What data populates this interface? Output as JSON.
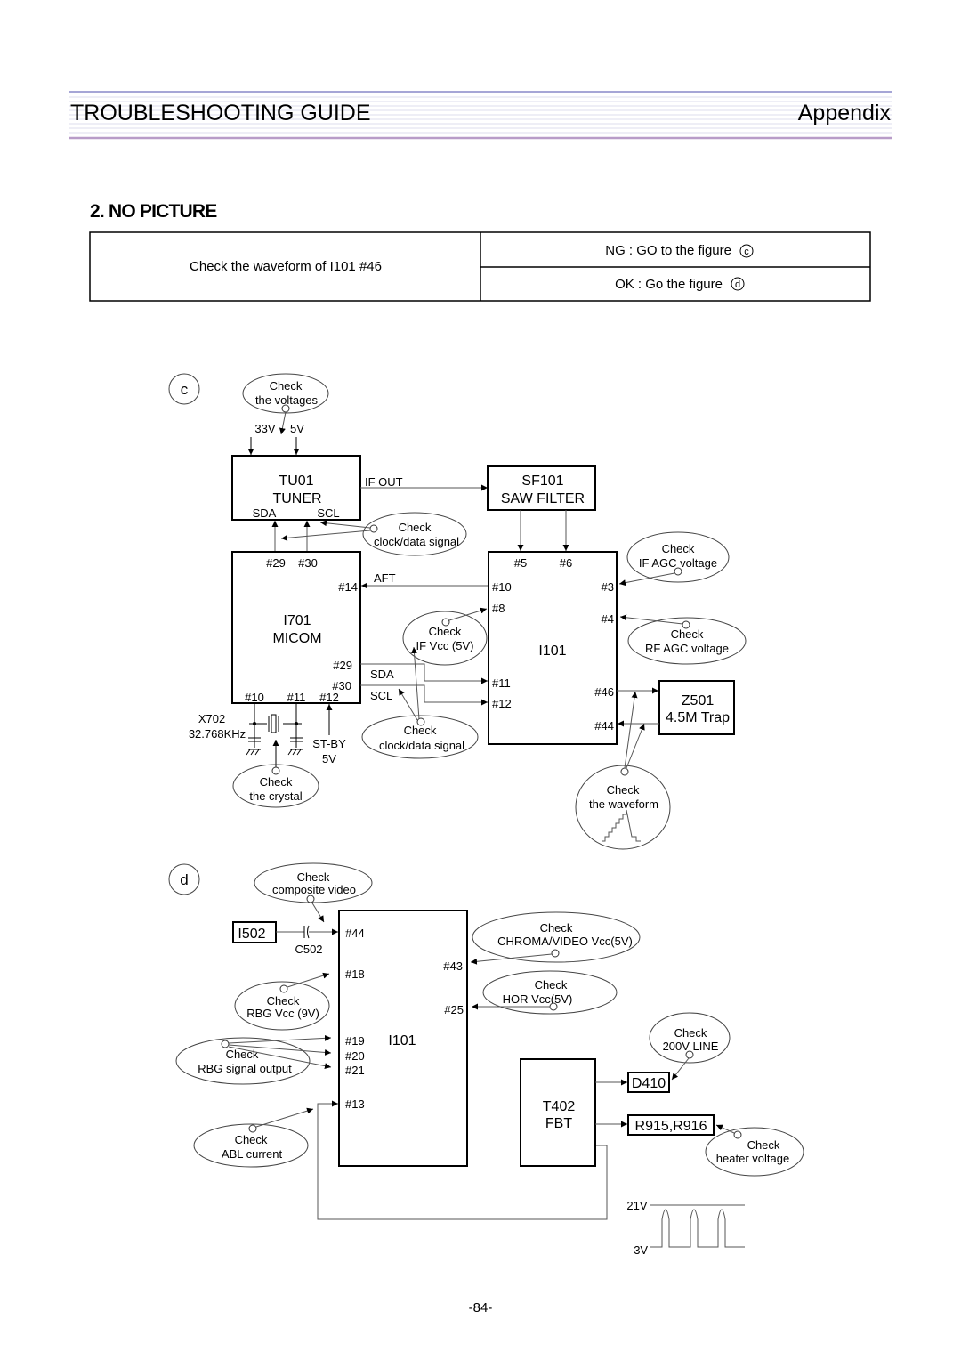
{
  "header": {
    "title": "TROUBLESHOOTING GUIDE",
    "section": "Appendix",
    "line_color": "#a6a6d6",
    "bottom_line_color": "#b89cc8"
  },
  "page_title": "2. NO PICTURE",
  "decision_table": {
    "condition": "Check the waveform of I101 #46",
    "ng": "NG : GO to the figure",
    "ng_ref": "c",
    "ok": "OK : Go the figure",
    "ok_ref": "d"
  },
  "figure_c": {
    "label": "c",
    "check_voltages": [
      "Check",
      "the voltages"
    ],
    "v33": "33V",
    "v5": "5V",
    "tuner": {
      "ref": "TU01",
      "name": "TUNER",
      "sda": "SDA",
      "scl": "SCL"
    },
    "if_out": "IF OUT",
    "saw": {
      "ref": "SF101",
      "name": "SAW FILTER"
    },
    "check_clock_top": [
      "Check",
      "clock/data signal"
    ],
    "micom": {
      "pin29_top": "#29",
      "pin30_top": "#30",
      "pin14": "#14",
      "ref": "I701",
      "name": "MICOM",
      "pin29": "#29",
      "pin30": "#30",
      "pin10": "#10",
      "pin11": "#11",
      "pin12": "#12"
    },
    "aft": "AFT",
    "sda": "SDA",
    "scl": "SCL",
    "i101": {
      "ref": "I101",
      "pin5": "#5",
      "pin6": "#6",
      "pin10": "#10",
      "pin8": "#8",
      "pin3": "#3",
      "pin4": "#4",
      "pin11": "#11",
      "pin12": "#12",
      "pin46": "#46",
      "pin44": "#44"
    },
    "check_if_vcc": [
      "Check",
      "IF Vcc (5V)"
    ],
    "check_if_agc": [
      "Check",
      "IF AGC voltage"
    ],
    "check_rf_agc": [
      "Check",
      "RF AGC voltage"
    ],
    "check_clock_bottom": [
      "Check",
      "clock/data signal"
    ],
    "trap": {
      "ref": "Z501",
      "name": "4.5M Trap"
    },
    "check_waveform": [
      "Check",
      "the waveform"
    ],
    "crystal": {
      "ref": "X702",
      "freq": "32.768KHz"
    },
    "standby": [
      "ST-BY",
      "5V"
    ],
    "check_crystal": [
      "Check",
      "the crystal"
    ]
  },
  "figure_d": {
    "label": "d",
    "check_composite": [
      "Check",
      "composite video"
    ],
    "i502": "I502",
    "c502": "C502",
    "i101": {
      "ref": "I101",
      "pin44": "#44",
      "pin18": "#18",
      "pin19": "#19",
      "pin20": "#20",
      "pin21": "#21",
      "pin13": "#13",
      "pin43": "#43",
      "pin25": "#25"
    },
    "check_chroma": [
      "Check",
      "CHROMA/VIDEO Vcc(5V)"
    ],
    "check_hor": [
      "Check",
      "HOR Vcc(5V)"
    ],
    "check_rbg_vcc": [
      "Check",
      "RBG Vcc (9V)"
    ],
    "check_rbg_out": [
      "Check",
      "RBG signal output"
    ],
    "check_abl": [
      "Check",
      "ABL current"
    ],
    "fbt": {
      "ref": "T402",
      "name": "FBT"
    },
    "d410": "D410",
    "r915": "R915,R916",
    "check_200v": [
      "Check",
      "200V LINE"
    ],
    "check_heater": [
      "Check",
      "heater voltage"
    ],
    "waveform": {
      "high": "21V",
      "low": "-3V"
    }
  },
  "page_number": "-84-"
}
